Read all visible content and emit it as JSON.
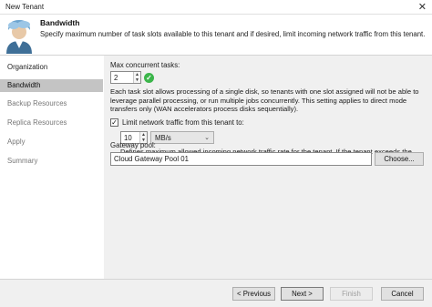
{
  "window": {
    "title": "New Tenant",
    "close_glyph": "✕"
  },
  "header": {
    "title": "Bandwidth",
    "description": "Specify maximum number of task slots available to this tenant and if desired, limit incoming network traffic from this tenant.",
    "icon": "tenant-avatar-icon"
  },
  "sidebar": {
    "items": [
      {
        "label": "Organization",
        "state": "normal"
      },
      {
        "label": "Bandwidth",
        "state": "active"
      },
      {
        "label": "Backup Resources",
        "state": "dim"
      },
      {
        "label": "Replica Resources",
        "state": "dim"
      },
      {
        "label": "Apply",
        "state": "dim"
      },
      {
        "label": "Summary",
        "state": "dim"
      }
    ]
  },
  "main": {
    "max_tasks_label": "Max concurrent tasks:",
    "max_tasks_value": "2",
    "task_slot_help": "Each task slot allows processing of a single disk, so tenants with one slot assigned will not be able to leverage parallel processing, or run multiple jobs concurrently. This setting applies to direct mode transfers only (WAN accelerators process disks sequentially).",
    "limit_checkbox_label": "Limit network traffic from this tenant to:",
    "limit_checked": true,
    "limit_value": "10",
    "limit_unit": "MB/s",
    "limit_help": "Defines maximum allowed incoming network traffic rate for the tenant.  If the tenant exceeds the assigned limit, the traffic will be throttled to the specified value.",
    "gateway_label": "Gateway pool:",
    "gateway_value": "Cloud Gateway Pool 01",
    "choose_label": "Choose..."
  },
  "footer": {
    "previous_label": "< Previous",
    "next_label": "Next >",
    "finish_label": "Finish",
    "cancel_label": "Cancel"
  },
  "colors": {
    "accent_ok": "#3bb54a",
    "active_nav": "#c4c4c4",
    "content_bg": "#f0f0f0"
  }
}
